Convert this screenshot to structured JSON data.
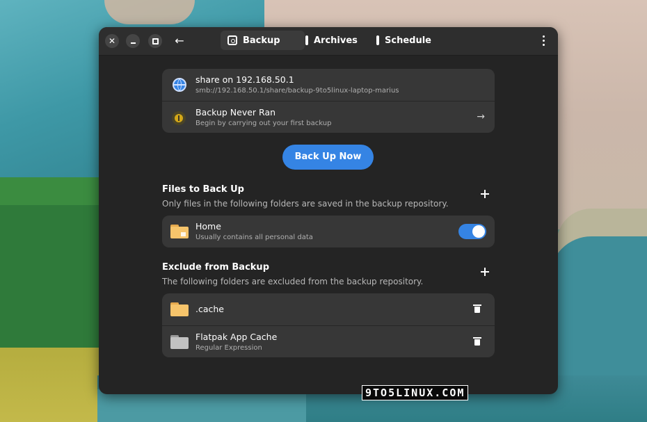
{
  "colors": {
    "accent": "#3584e4",
    "window_bg": "#242424",
    "card_bg": "#373737",
    "headerbar_bg": "#2e2e2e",
    "folder_yellow": "#f6c46b",
    "warning": "#d3a719"
  },
  "headerbar": {
    "tabs": [
      {
        "label": "Backup",
        "icon": "backup-icon",
        "active": true
      },
      {
        "label": "Archives",
        "icon": "archives-icon",
        "active": false
      },
      {
        "label": "Schedule",
        "icon": "schedule-icon",
        "active": false
      }
    ]
  },
  "status": {
    "repository": {
      "title": "share on 192.168.50.1",
      "subtitle": "smb://192.168.50.1/share/backup-9to5linux-laptop-marius",
      "icon": "globe-icon"
    },
    "last_backup": {
      "title": "Backup Never Ran",
      "subtitle": "Begin by carrying out your first backup",
      "icon": "info-icon"
    }
  },
  "actions": {
    "back_up_now": "Back Up Now"
  },
  "include": {
    "title": "Files to Back Up",
    "description": "Only files in the following folders are saved in the backup repository.",
    "items": [
      {
        "title": "Home",
        "subtitle": "Usually contains all personal data",
        "enabled": true,
        "icon": "home-folder-icon"
      }
    ]
  },
  "exclude": {
    "title": "Exclude from Backup",
    "description": "The following folders are excluded from the backup repository.",
    "items": [
      {
        "title": ".cache",
        "subtitle": "",
        "icon": "folder-icon"
      },
      {
        "title": "Flatpak App Cache",
        "subtitle": "Regular Expression",
        "icon": "folder-icon"
      }
    ]
  },
  "watermark": "9TO5LINUX.COM"
}
